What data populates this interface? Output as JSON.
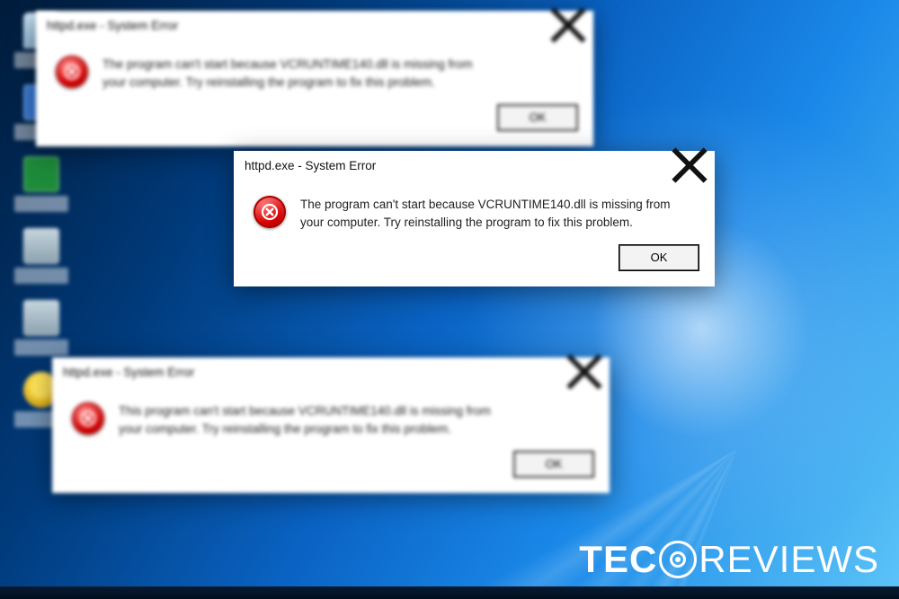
{
  "dialogs": {
    "back_top": {
      "title": "httpd.exe - System Error",
      "message": "The program can't start because VCRUNTIME140.dll is missing from your computer. Try reinstalling the program to fix this problem.",
      "ok": "OK"
    },
    "front": {
      "title": "httpd.exe - System Error",
      "message": "The program can't start because VCRUNTIME140.dll is missing from your computer. Try reinstalling the program to fix this problem.",
      "ok": "OK"
    },
    "back_bottom": {
      "title": "httpd.exe - System Error",
      "message": "This program can't start because VCRUNTIME140.dll is missing from your computer. Try reinstalling the program to fix this problem.",
      "ok": "OK"
    }
  },
  "watermark": {
    "brand_left": "TEC",
    "brand_right": "REVIEWS"
  },
  "desktop_icons": [
    {
      "kind": "bin"
    },
    {
      "kind": "blue"
    },
    {
      "kind": "green"
    },
    {
      "kind": "folder"
    },
    {
      "kind": "folder"
    },
    {
      "kind": "yellow"
    }
  ]
}
